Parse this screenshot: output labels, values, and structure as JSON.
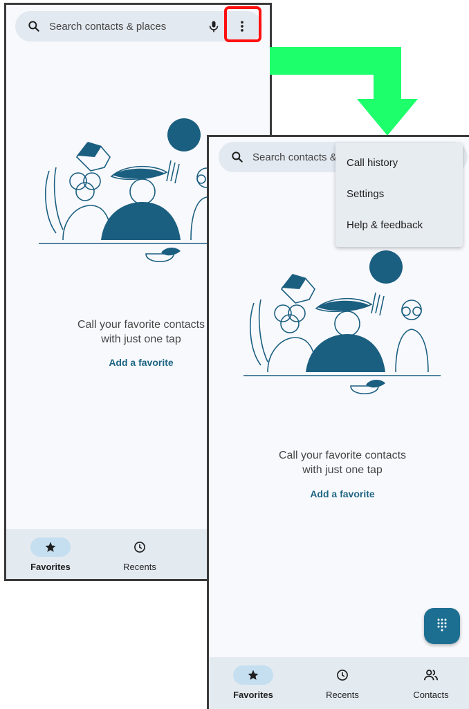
{
  "screen1": {
    "search": {
      "placeholder": "Search contacts & places",
      "icons": [
        "search-icon",
        "mic-icon",
        "more-vert-icon"
      ]
    },
    "empty_state": {
      "message_line1": "Call your favorite contacts",
      "message_line2": "with just one tap",
      "action": "Add a favorite"
    },
    "nav": [
      {
        "label": "Favorites",
        "icon": "star-icon",
        "active": true
      },
      {
        "label": "Recents",
        "icon": "clock-icon",
        "active": false
      }
    ]
  },
  "screen2": {
    "search": {
      "placeholder": "Search contacts &",
      "icons": [
        "search-icon"
      ]
    },
    "menu": {
      "items": [
        "Call history",
        "Settings",
        "Help & feedback"
      ]
    },
    "empty_state": {
      "message_line1": "Call your favorite contacts",
      "message_line2": "with just one tap",
      "action": "Add a favorite"
    },
    "fab_icon": "dialpad-icon",
    "nav": [
      {
        "label": "Favorites",
        "icon": "star-icon",
        "active": true
      },
      {
        "label": "Recents",
        "icon": "clock-icon",
        "active": false
      },
      {
        "label": "Contacts",
        "icon": "contacts-icon",
        "active": false
      }
    ]
  },
  "annotation": {
    "highlight_color": "#ff1010",
    "arrow_color": "#1dff6b"
  },
  "colors": {
    "accent": "#1e6582",
    "illustration": "#1b5f80",
    "nav_background": "#e3eaf0",
    "active_pill": "#c5dff0"
  }
}
